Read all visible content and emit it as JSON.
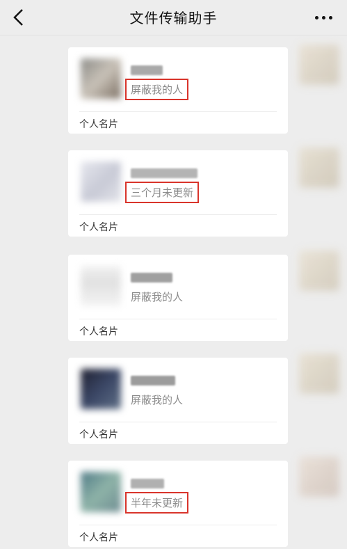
{
  "header": {
    "title": "文件传输助手",
    "back_icon": "chevron-left-icon",
    "more_icon": "more-dots-icon"
  },
  "messages": [
    {
      "status": "屏蔽我的人",
      "highlighted": true,
      "card_type": "个人名片"
    },
    {
      "status": "三个月未更新",
      "highlighted": true,
      "card_type": "个人名片"
    },
    {
      "status": "屏蔽我的人",
      "highlighted": false,
      "card_type": "个人名片"
    },
    {
      "status": "屏蔽我的人",
      "highlighted": false,
      "card_type": "个人名片"
    },
    {
      "status": "半年未更新",
      "highlighted": true,
      "card_type": "个人名片"
    }
  ],
  "colors": {
    "highlight_border": "#d9342b",
    "background": "#ededed",
    "card": "#ffffff"
  }
}
